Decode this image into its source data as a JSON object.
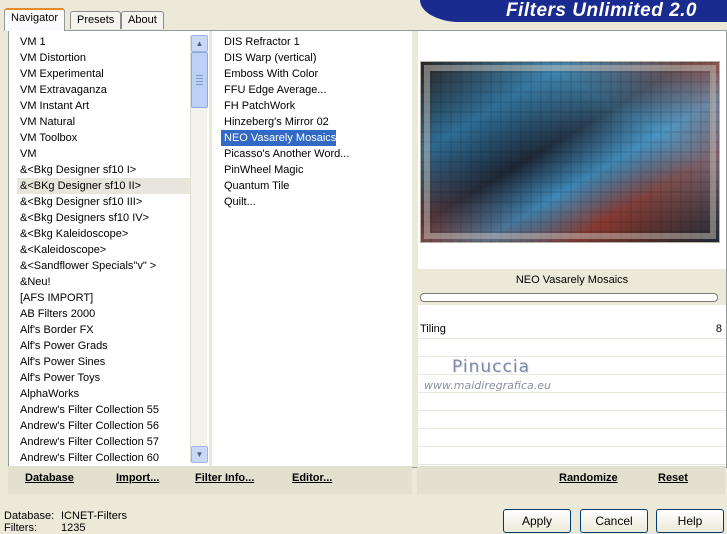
{
  "tabs": [
    "Navigator",
    "Presets",
    "About"
  ],
  "banner_title": "Filters Unlimited 2.0",
  "categories": [
    "VM 1",
    "VM Distortion",
    "VM Experimental",
    "VM Extravaganza",
    "VM Instant Art",
    "VM Natural",
    "VM Toolbox",
    "VM",
    "&<Bkg Designer sf10 I>",
    "&<BKg Designer sf10 II>",
    "&<Bkg Designer sf10 III>",
    "&<Bkg Designers sf10 IV>",
    "&<Bkg Kaleidoscope>",
    "&<Kaleidoscope>",
    "&<Sandflower Specials\"v\" >",
    "&Neu!",
    "[AFS IMPORT]",
    "AB Filters 2000",
    "Alf's Border FX",
    "Alf's Power Grads",
    "Alf's Power Sines",
    "Alf's Power Toys",
    "AlphaWorks",
    "Andrew's Filter Collection 55",
    "Andrew's Filter Collection 56",
    "Andrew's Filter Collection 57",
    "Andrew's Filter Collection 60"
  ],
  "selected_category_index": 9,
  "filters": [
    "DIS Refractor 1",
    "DIS Warp (vertical)",
    "Emboss With Color",
    "FFU Edge Average...",
    "FH PatchWork",
    "Hinzeberg's Mirror 02",
    "NEO Vasarely Mosaics",
    "Picasso's Another Word...",
    "PinWheel Magic",
    "Quantum Tile",
    "Quilt..."
  ],
  "selected_filter_index": 6,
  "selected_filter_name": "NEO Vasarely Mosaics",
  "params": [
    {
      "name": "Tiling",
      "value": "8"
    }
  ],
  "watermark": {
    "name": "Pinuccia",
    "url": "www.maidiregrafica.eu"
  },
  "toolbar_left": {
    "database": "Database",
    "import": "Import...",
    "filter_info": "Filter Info...",
    "editor": "Editor..."
  },
  "toolbar_right": {
    "randomize": "Randomize",
    "reset": "Reset"
  },
  "status": {
    "database_label": "Database:",
    "database_value": "ICNET-Filters",
    "filters_label": "Filters:",
    "filters_value": "1235"
  },
  "buttons": {
    "apply": "Apply",
    "cancel": "Cancel",
    "help": "Help"
  },
  "colors": {
    "banner": "#1a2b8f",
    "selection": "#316ac5",
    "dialog_bg": "#ece9d8"
  }
}
